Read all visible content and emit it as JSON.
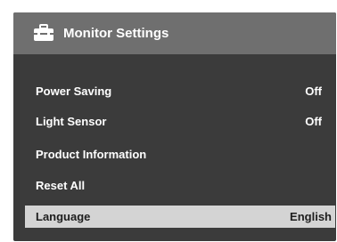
{
  "header": {
    "icon": "toolbox-icon",
    "title": "Monitor Settings"
  },
  "menu": {
    "items": [
      {
        "label": "Power Saving",
        "value": "Off",
        "selected": false
      },
      {
        "label": "Light Sensor",
        "value": "Off",
        "selected": false
      },
      {
        "label": "Product Information",
        "value": "",
        "selected": false
      },
      {
        "label": "Reset All",
        "value": "",
        "selected": false
      },
      {
        "label": "Language",
        "value": "English",
        "selected": true
      }
    ]
  },
  "colors": {
    "panel_background": "#3b3b3b",
    "header_background": "#6f6f6f",
    "selected_background": "#d4d4d4",
    "text": "#ffffff",
    "selected_text": "#1e1e1e"
  }
}
